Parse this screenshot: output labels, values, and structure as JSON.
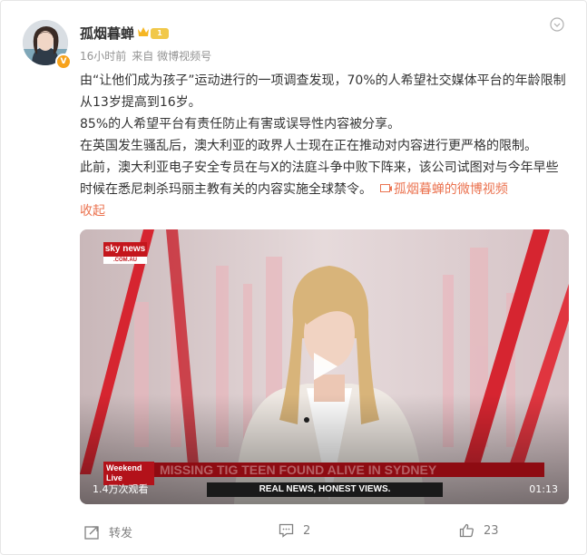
{
  "post": {
    "username": "孤烟暮蝉",
    "level": "1",
    "time": "16小时前",
    "source": "来自 微博视频号",
    "paragraphs": [
      "由“让他们成为孩子”运动进行的一项调查发现，70%的人希望社交媒体平台的年龄限制从13岁提高到16岁。",
      "85%的人希望平台有责任防止有害或误导性内容被分享。",
      "在英国发生骚乱后，澳大利亚的政界人士现在正在推动对内容进行更严格的限制。"
    ],
    "last_paragraph": "此前，澳大利亚电子安全专员在与X的法庭斗争中败下阵来，该公司试图对与今年早些时候在悉尼刺杀玛丽主教有关的内容实施全球禁令。",
    "video_link": "孤烟暮蝉的微博视频",
    "collapse": "收起"
  },
  "video": {
    "logo_main": "sky news",
    "logo_sub": ".COM.AU",
    "bug_line1": "Weekend",
    "bug_line2": "Live",
    "ticker": "MISSING TIG TEEN FOUND ALIVE IN SYDNEY",
    "tagline": "REAL NEWS, HONEST VIEWS.",
    "views": "1.4万次观看",
    "duration": "01:13"
  },
  "actions": {
    "repost": "转发",
    "comments": "2",
    "likes": "23"
  }
}
